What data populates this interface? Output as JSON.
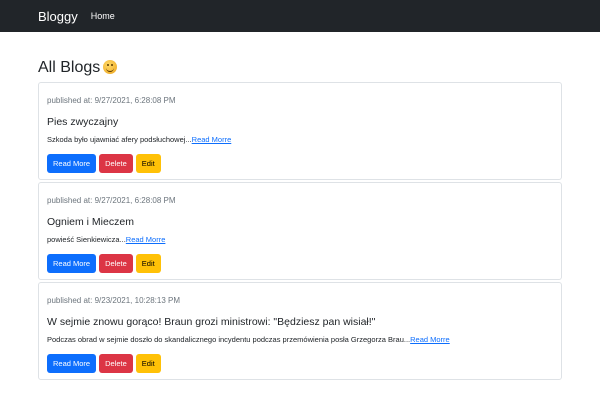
{
  "navbar": {
    "brand": "Bloggy",
    "links": [
      "Home"
    ]
  },
  "page": {
    "title": "All Blogs",
    "emoji_icon": "smiling-face-emoji"
  },
  "blogs": [
    {
      "published": "published at: 9/27/2021, 6:28:08 PM",
      "title": "Pies zwyczajny",
      "desc": "Szkoda było ujawniać afery podsłuchowej...",
      "read_link": "Read Morre",
      "buttons": {
        "read": "Read More",
        "delete": "Delete",
        "edit": "Edit"
      }
    },
    {
      "published": "published at: 9/27/2021, 6:28:08 PM",
      "title": "Ogniem i Mieczem",
      "desc": "powieść Sienkiewicza...",
      "read_link": "Read Morre",
      "buttons": {
        "read": "Read More",
        "delete": "Delete",
        "edit": "Edit"
      }
    },
    {
      "published": "published at: 9/23/2021, 10:28:13 PM",
      "title": "W sejmie znowu gorąco! Braun grozi ministrowi: \"Będziesz pan wisiał!\"",
      "desc": "Podczas obrad w sejmie doszło do skandalicznego incydentu podczas przemówienia posła Grzegorza Brau...",
      "read_link": "Read Morre",
      "buttons": {
        "read": "Read More",
        "delete": "Delete",
        "edit": "Edit"
      }
    }
  ],
  "colors": {
    "navbar": "#212529",
    "primary": "#0d6efd",
    "danger": "#dc3545",
    "warning": "#ffc107"
  }
}
